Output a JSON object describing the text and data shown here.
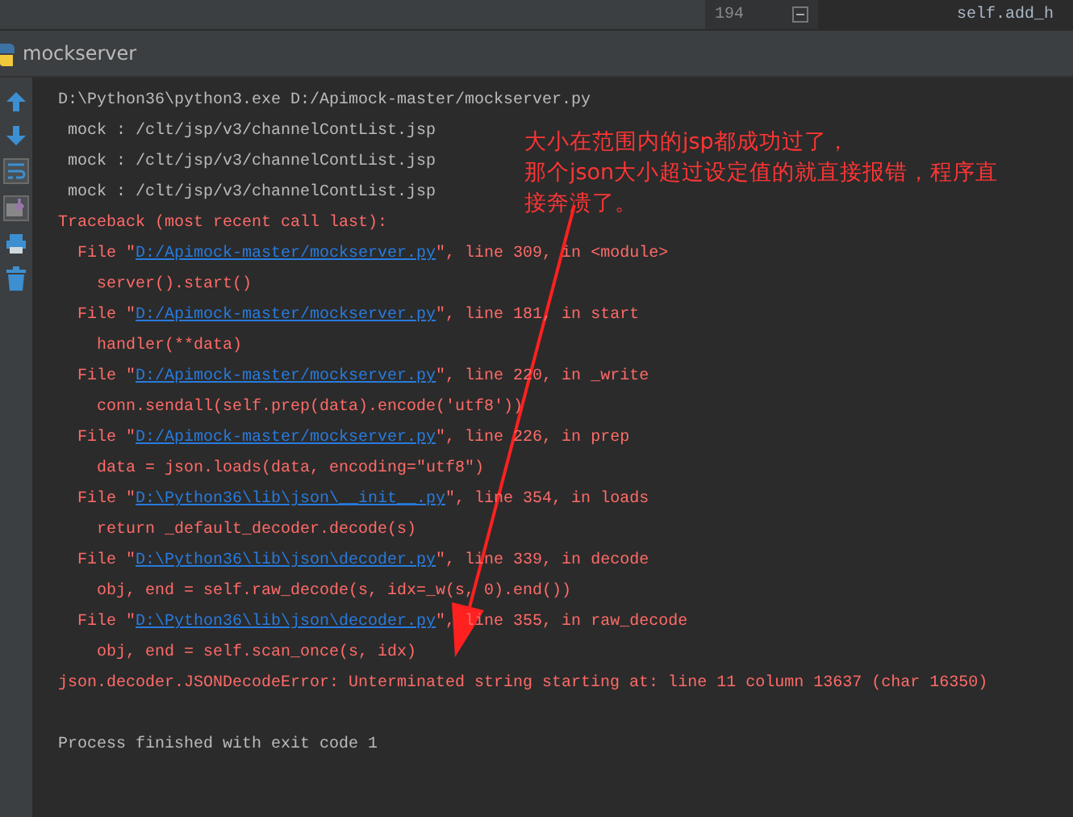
{
  "editor_strip": {
    "line_number": "194",
    "code": "self.add_h"
  },
  "run_panel": {
    "title": "mockserver"
  },
  "toolbar": [
    {
      "kind": "up"
    },
    {
      "kind": "down"
    },
    {
      "kind": "wrap"
    },
    {
      "kind": "scroll"
    },
    {
      "kind": "print"
    },
    {
      "kind": "trash"
    }
  ],
  "console": [
    {
      "kind": "command",
      "text": "D:\\Python36\\python3.exe D:/Apimock-master/mockserver.py"
    },
    {
      "kind": "output",
      "text": " mock : /clt/jsp/v3/channelContList.jsp"
    },
    {
      "kind": "output",
      "text": " mock : /clt/jsp/v3/channelContList.jsp"
    },
    {
      "kind": "output",
      "text": " mock : /clt/jsp/v3/channelContList.jsp"
    },
    {
      "kind": "error",
      "text": "Traceback (most recent call last):"
    },
    {
      "kind": "file",
      "prefix": "  File \"",
      "link": "D:/Apimock-master/mockserver.py",
      "suffix": "\", line 309, in <module>"
    },
    {
      "kind": "code",
      "text": "    server().start()"
    },
    {
      "kind": "file",
      "prefix": "  File \"",
      "link": "D:/Apimock-master/mockserver.py",
      "suffix": "\", line 181, in start"
    },
    {
      "kind": "code",
      "text": "    handler(**data)"
    },
    {
      "kind": "file",
      "prefix": "  File \"",
      "link": "D:/Apimock-master/mockserver.py",
      "suffix": "\", line 220, in _write"
    },
    {
      "kind": "code",
      "text": "    conn.sendall(self.prep(data).encode('utf8'))"
    },
    {
      "kind": "file",
      "prefix": "  File \"",
      "link": "D:/Apimock-master/mockserver.py",
      "suffix": "\", line 226, in prep"
    },
    {
      "kind": "code",
      "text": "    data = json.loads(data, encoding=\"utf8\")"
    },
    {
      "kind": "file",
      "prefix": "  File \"",
      "link": "D:\\Python36\\lib\\json\\__init__.py",
      "suffix": "\", line 354, in loads"
    },
    {
      "kind": "code",
      "text": "    return _default_decoder.decode(s)"
    },
    {
      "kind": "file",
      "prefix": "  File \"",
      "link": "D:\\Python36\\lib\\json\\decoder.py",
      "suffix": "\", line 339, in decode"
    },
    {
      "kind": "code",
      "text": "    obj, end = self.raw_decode(s, idx=_w(s, 0).end())"
    },
    {
      "kind": "file",
      "prefix": "  File \"",
      "link": "D:\\Python36\\lib\\json\\decoder.py",
      "suffix": "\", line 355, in raw_decode"
    },
    {
      "kind": "code",
      "text": "    obj, end = self.scan_once(s, idx)"
    },
    {
      "kind": "error",
      "text": "json.decoder.JSONDecodeError: Unterminated string starting at: line 11 column 13637 (char 16350)"
    },
    {
      "kind": "blank"
    },
    {
      "kind": "command",
      "text": "Process finished with exit code 1"
    }
  ],
  "annotation": {
    "lines": [
      "大小在范围内的jsp都成功过了，",
      "那个json大小超过设定值的就直接报错，程序直",
      "接奔溃了。"
    ]
  }
}
